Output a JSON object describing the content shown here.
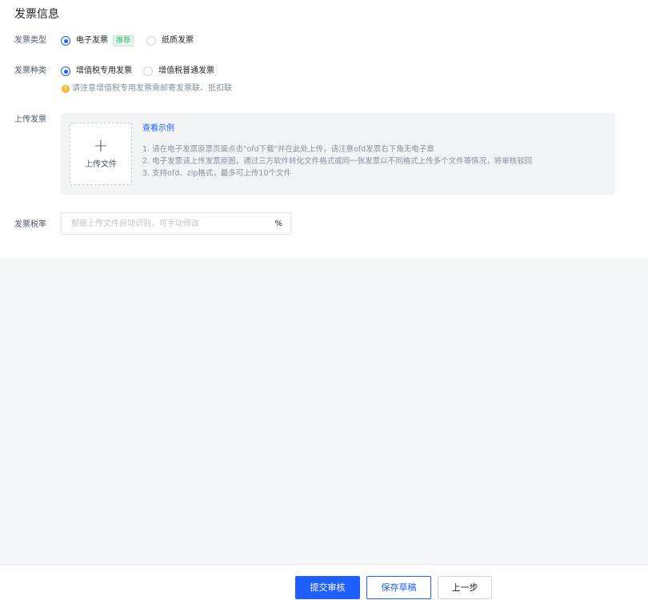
{
  "section_title": "发票信息",
  "invoice_type": {
    "label": "发票类型",
    "options": [
      {
        "label": "电子发票",
        "tag": "推荐",
        "checked": true
      },
      {
        "label": "纸质发票",
        "checked": false
      }
    ]
  },
  "invoice_kind": {
    "label": "发票种类",
    "options": [
      {
        "label": "增值税专用发票",
        "checked": true
      },
      {
        "label": "增值税普通发票",
        "checked": false
      }
    ],
    "hint": "请注意增值税专用发票需邮寄发票联、抵扣联",
    "hint_icon": "!"
  },
  "upload": {
    "label": "上传发票",
    "button_icon": "+",
    "button_label": "上传文件",
    "example_link": "查看示例",
    "notes": [
      "1. 请在电子发票原票页面点击\"ofd下载\"并在此处上传，请注意ofd发票右下角无电子章",
      "2. 电子发票请上传发票原图，通过三方软件转化文件格式或同一张发票以不同格式上传多个文件等情况，将审核驳回",
      "3. 支持ofd、zip格式，最多可上传10个文件"
    ]
  },
  "tax_rate": {
    "label": "发票税率",
    "placeholder": "根据上传文件自动识别，可手动修改",
    "value": "",
    "suffix": "%"
  },
  "footer": {
    "submit_label": "提交审核",
    "save_draft_label": "保存草稿",
    "previous_label": "上一步"
  },
  "colors": {
    "primary": "#1f5fff",
    "tag_green": "#2bb673",
    "warning": "#f7b52c"
  }
}
